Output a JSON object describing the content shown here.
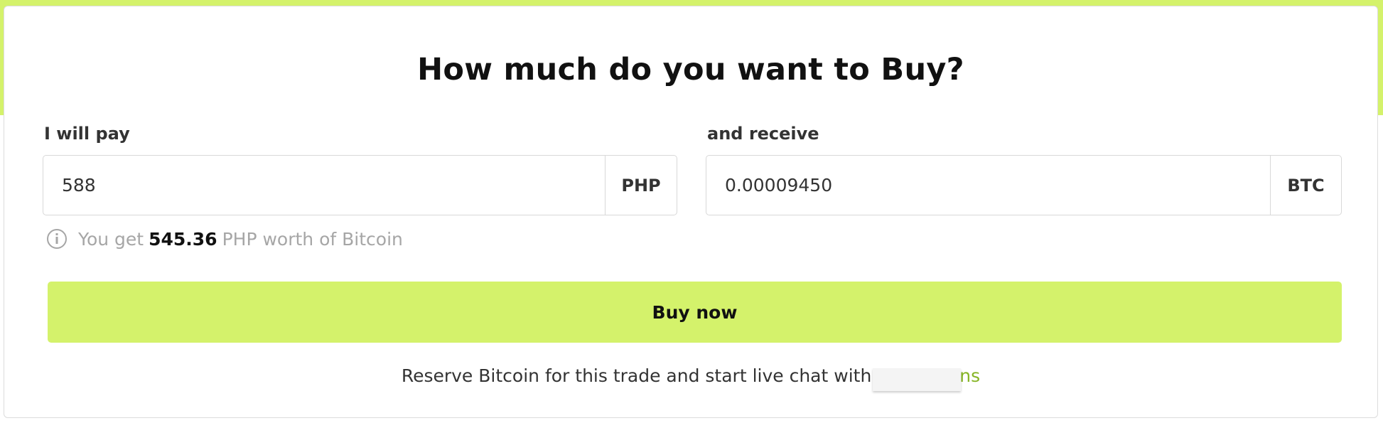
{
  "title": "How much do you want to Buy?",
  "pay": {
    "label": "I will pay",
    "value": "588",
    "currency": "PHP"
  },
  "receive": {
    "label": "and receive",
    "value": "0.00009450",
    "currency": "BTC"
  },
  "info": {
    "prefix": "You get",
    "amount": "545.36",
    "suffix": "PHP worth of Bitcoin"
  },
  "buy_button_label": "Buy now",
  "footer": {
    "text": "Reserve Bitcoin for this trade and start live chat with",
    "trader_visible_suffix": "ns"
  },
  "colors": {
    "accent": "#d4f26b",
    "link": "#87b526"
  }
}
